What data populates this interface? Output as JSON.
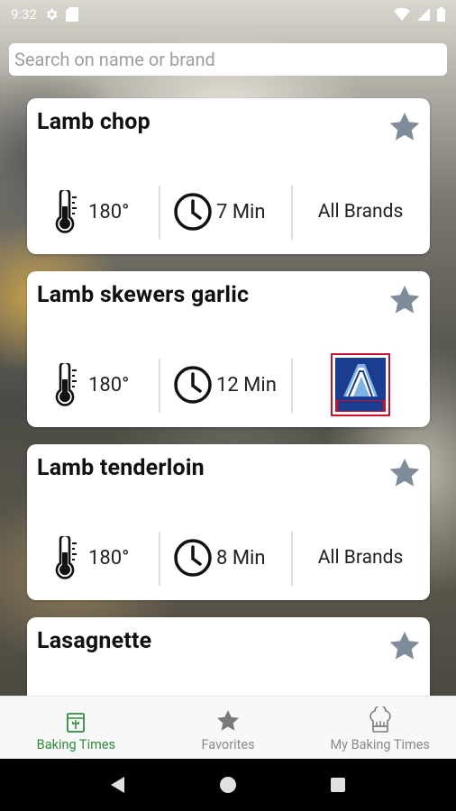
{
  "status": {
    "time": "9:32"
  },
  "search": {
    "placeholder": "Search on name or brand",
    "value": ""
  },
  "items": [
    {
      "title": "Lamb chop",
      "temperature": "180°",
      "time": "7 Min",
      "brand": "All Brands",
      "brand_type": "text"
    },
    {
      "title": "Lamb skewers garlic",
      "temperature": "180°",
      "time": "12 Min",
      "brand": "ALDI",
      "brand_type": "logo"
    },
    {
      "title": "Lamb tenderloin",
      "temperature": "180°",
      "time": "8 Min",
      "brand": "All Brands",
      "brand_type": "text"
    },
    {
      "title": "Lasagnette",
      "temperature": "",
      "time": "",
      "brand": "",
      "brand_type": "text"
    }
  ],
  "nav": {
    "tabs": [
      {
        "label": "Baking Times",
        "icon": "oven-icon",
        "active": true
      },
      {
        "label": "Favorites",
        "icon": "star-icon",
        "active": false
      },
      {
        "label": "My Baking Times",
        "icon": "chef-hat-icon",
        "active": false
      }
    ]
  },
  "colors": {
    "accent": "#2e8b3d",
    "star": "#7f8c99",
    "aldi_blue": "#1b3d8f",
    "aldi_red": "#c8102e"
  }
}
